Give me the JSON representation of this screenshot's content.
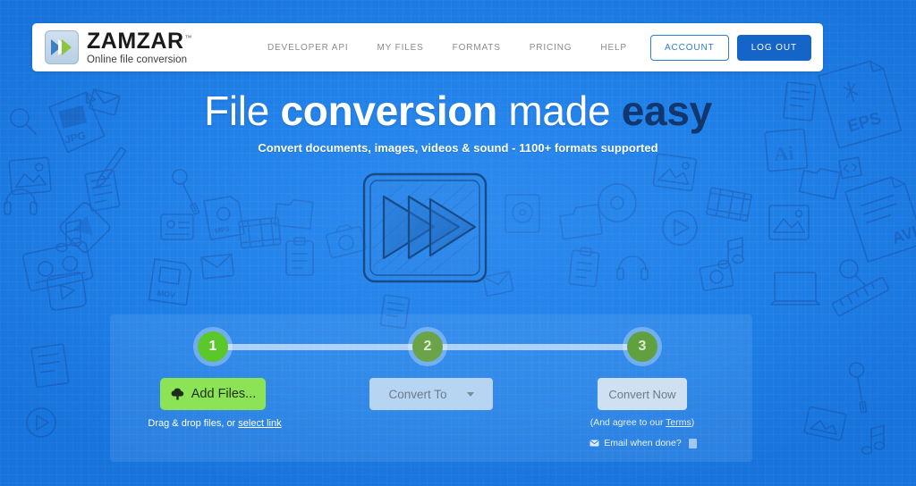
{
  "brand": {
    "name": "ZAMZAR",
    "trademark": "™",
    "tagline": "Online file conversion",
    "logo_icon": "double-chevron-icon",
    "logo_colors": {
      "chevron_blue": "#3f7fc4",
      "chevron_green": "#8cc63f"
    }
  },
  "nav": {
    "links": [
      {
        "label": "DEVELOPER API",
        "name": "nav-developer-api"
      },
      {
        "label": "MY FILES",
        "name": "nav-my-files"
      },
      {
        "label": "FORMATS",
        "name": "nav-formats"
      },
      {
        "label": "PRICING",
        "name": "nav-pricing"
      },
      {
        "label": "HELP",
        "name": "nav-help"
      }
    ],
    "account_label": "ACCOUNT",
    "logout_label": "LOG OUT"
  },
  "hero": {
    "headline_part1": "File ",
    "headline_part2": "conversion",
    "headline_part3": " made ",
    "headline_part4": "easy",
    "subheadline": "Convert documents, images, videos & sound - 1100+ formats supported",
    "sketch_icon": "fast-forward-sketch-icon"
  },
  "converter": {
    "steps": [
      {
        "number": "1",
        "state": "active"
      },
      {
        "number": "2",
        "state": "inactive"
      },
      {
        "number": "3",
        "state": "inactive"
      }
    ],
    "add_files_label": "Add Files...",
    "add_files_icon": "upload-cloud-icon",
    "drag_drop_text": "Drag & drop files, or ",
    "select_link_label": "select link",
    "convert_to_label": "Convert To",
    "convert_to_icon": "chevron-down-icon",
    "convert_now_label": "Convert Now",
    "terms_prefix": "(And agree to our ",
    "terms_link_label": "Terms",
    "terms_suffix": ")",
    "email_icon": "envelope-icon",
    "email_label": "Email when done?",
    "email_checked": false
  },
  "colors": {
    "page_background": "#1f80e8",
    "accent_green": "#8ce356",
    "step_active_green": "#5cc72a",
    "logout_blue": "#1565c8",
    "headline_accent": "#12366e",
    "panel_overlay": "rgba(255,255,255,0.085)"
  },
  "background_doodles": [
    "jpg-file-icon",
    "pencil-icon",
    "music-note-icon",
    "cassette-tape-icon",
    "video-play-icon",
    "mov-file-icon",
    "mp3-file-icon",
    "photo-frame-icon",
    "eps-file-icon",
    "ai-file-icon",
    "avi-file-icon",
    "code-brackets-icon",
    "magnifier-icon",
    "wrench-icon",
    "ruler-icon",
    "folder-icon",
    "envelope-icon",
    "clipboard-icon",
    "laptop-icon",
    "camera-icon",
    "document-icon",
    "headphones-icon",
    "contact-card-icon",
    "disc-icon"
  ]
}
